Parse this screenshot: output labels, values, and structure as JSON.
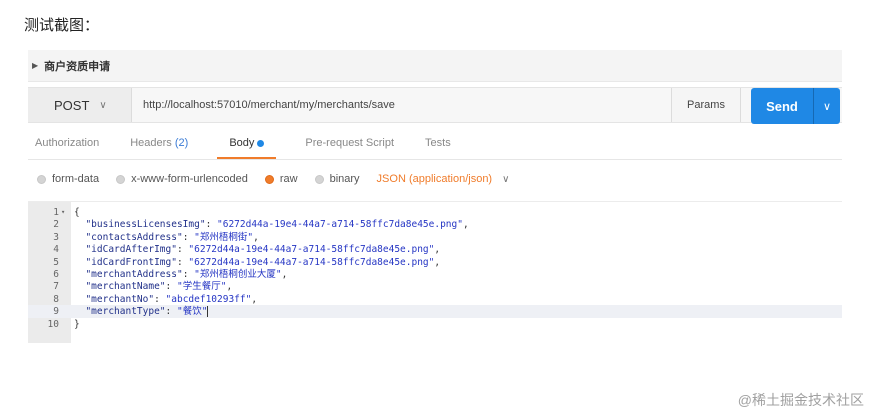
{
  "caption": "测试截图：",
  "request": {
    "title": "商户资质申请",
    "method": "POST",
    "url": "http://localhost:57010/merchant/my/merchants/save",
    "params_label": "Params",
    "send_label": "Send"
  },
  "tabs": [
    {
      "label": "Authorization"
    },
    {
      "label": "Headers",
      "count": "(2)"
    },
    {
      "label": "Body"
    },
    {
      "label": "Pre-request Script"
    },
    {
      "label": "Tests"
    }
  ],
  "body_options": {
    "form_data": "form-data",
    "urlencoded": "x-www-form-urlencoded",
    "raw": "raw",
    "binary": "binary",
    "content_type": "JSON (application/json)",
    "selected": "raw"
  },
  "editor": {
    "lines": [
      {
        "num": "1",
        "fold": true,
        "key": "",
        "value": "",
        "text": "{"
      },
      {
        "num": "2",
        "key": "\"businessLicensesImg\"",
        "value": "\"6272d44a-19e4-44a7-a714-58ffc7da8e45e.png\"",
        "sep": ","
      },
      {
        "num": "3",
        "key": "\"contactsAddress\"",
        "value": "\"郑州梧桐街\"",
        "sep": ","
      },
      {
        "num": "4",
        "key": "\"idCardAfterImg\"",
        "value": "\"6272d44a-19e4-44a7-a714-58ffc7da8e45e.png\"",
        "sep": ","
      },
      {
        "num": "5",
        "key": "\"idCardFrontImg\"",
        "value": "\"6272d44a-19e4-44a7-a714-58ffc7da8e45e.png\"",
        "sep": ","
      },
      {
        "num": "6",
        "key": "\"merchantAddress\"",
        "value": "\"郑州梧桐创业大厦\"",
        "sep": ","
      },
      {
        "num": "7",
        "key": "\"merchantName\"",
        "value": "\"学生餐厅\"",
        "sep": ","
      },
      {
        "num": "8",
        "key": "\"merchantNo\"",
        "value": "\"abcdef10293ff\"",
        "sep": ","
      },
      {
        "num": "9",
        "key": "\"merchantType\"",
        "value": "\"餐饮\"",
        "sep": ""
      },
      {
        "num": "10",
        "key": "",
        "value": "",
        "text": "}"
      }
    ]
  },
  "watermark": "@稀土掘金技术社区",
  "colors": {
    "send": "#1f88e5",
    "accent": "#f07c2b"
  }
}
